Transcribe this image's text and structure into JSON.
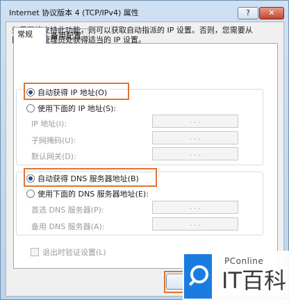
{
  "window": {
    "title": "Internet 协议版本 4 (TCP/IPv4) 属性",
    "help_label": "?",
    "close_label": "✕"
  },
  "tabs": [
    {
      "label": "常规",
      "active": true
    },
    {
      "label": "备用配置",
      "active": false
    }
  ],
  "description": "如果网络支持此功能，则可以获取自动指派的 IP 设置。否则，您需要从网络系统管理员处获得适当的 IP 设置。",
  "ip_section": {
    "auto_label": "自动获得 IP 地址(O)",
    "manual_label": "使用下面的 IP 地址(S):",
    "selected": "auto",
    "fields": [
      {
        "label": "IP 地址(I):",
        "value": ".   .   ."
      },
      {
        "label": "子网掩码(U):",
        "value": ".   .   ."
      },
      {
        "label": "默认网关(D):",
        "value": ".   .   ."
      }
    ]
  },
  "dns_section": {
    "auto_label": "自动获得 DNS 服务器地址(B)",
    "manual_label": "使用下面的 DNS 服务器地址(E):",
    "selected": "auto",
    "fields": [
      {
        "label": "首选 DNS 服务器(P):",
        "value": ".   .   ."
      },
      {
        "label": "备用 DNS 服务器(A):",
        "value": ".   .   ."
      }
    ]
  },
  "validate_label": "退出时验证设置(L)",
  "watermark": {
    "small": "PConline",
    "big": "IT百科"
  },
  "colors": {
    "highlight": "#e2732f",
    "watermark_blue": "#1b7ce0"
  }
}
